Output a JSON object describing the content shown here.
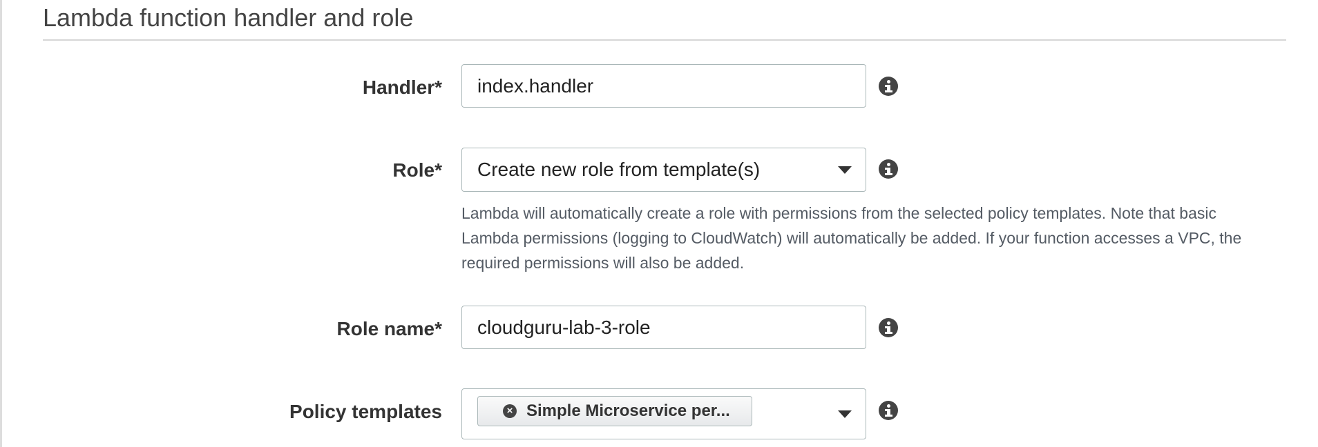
{
  "section": {
    "title": "Lambda function handler and role"
  },
  "handler": {
    "label": "Handler*",
    "value": "index.handler"
  },
  "role": {
    "label": "Role*",
    "selected": "Create new role from template(s)",
    "help_text": "Lambda will automatically create a role with permissions from the selected policy templates. Note that basic Lambda permissions (logging to CloudWatch) will automatically be added. If your function accesses a VPC, the required permissions will also be added."
  },
  "role_name": {
    "label": "Role name*",
    "value": "cloudguru-lab-3-role"
  },
  "policy_templates": {
    "label": "Policy templates",
    "tokens": [
      {
        "label": "Simple Microservice per...",
        "remove_icon": "x-circle-icon"
      }
    ]
  },
  "icons": {
    "info": "info-icon",
    "dropdown": "caret-down-icon"
  }
}
